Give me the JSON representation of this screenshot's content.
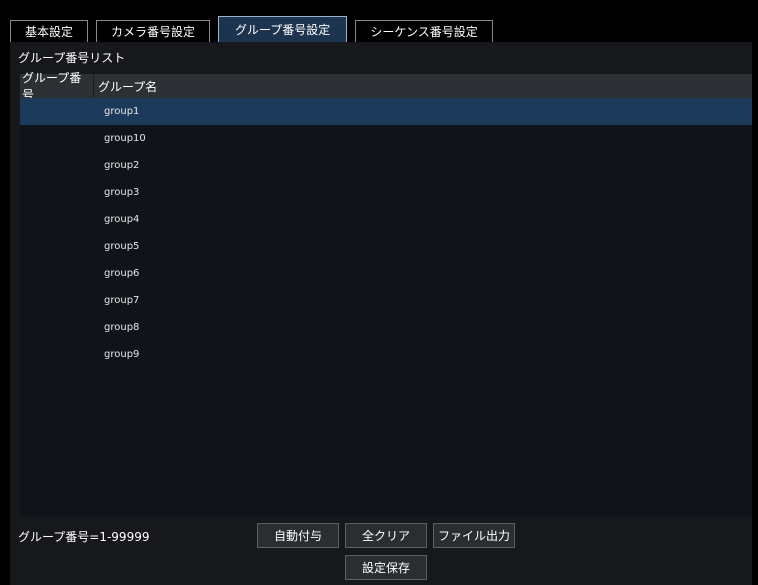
{
  "tabs": [
    {
      "label": "基本設定",
      "active": false
    },
    {
      "label": "カメラ番号設定",
      "active": false
    },
    {
      "label": "グループ番号設定",
      "active": true
    },
    {
      "label": "シーケンス番号設定",
      "active": false
    }
  ],
  "list": {
    "title": "グループ番号リスト",
    "columns": [
      "グループ番号",
      "グループ名"
    ],
    "rows": [
      {
        "number": "",
        "name": "group1",
        "selected": true
      },
      {
        "number": "",
        "name": "group10",
        "selected": false
      },
      {
        "number": "",
        "name": "group2",
        "selected": false
      },
      {
        "number": "",
        "name": "group3",
        "selected": false
      },
      {
        "number": "",
        "name": "group4",
        "selected": false
      },
      {
        "number": "",
        "name": "group5",
        "selected": false
      },
      {
        "number": "",
        "name": "group6",
        "selected": false
      },
      {
        "number": "",
        "name": "group7",
        "selected": false
      },
      {
        "number": "",
        "name": "group8",
        "selected": false
      },
      {
        "number": "",
        "name": "group9",
        "selected": false
      }
    ]
  },
  "footer": {
    "range_text": "グループ番号=1-99999",
    "auto_assign_label": "自動付与",
    "clear_all_label": "全クリア",
    "file_output_label": "ファイル出力",
    "save_label": "設定保存"
  },
  "colors": {
    "active_tab": "#1d3450",
    "selected_row": "#1c3a5a",
    "header_bg": "#2d3035"
  }
}
